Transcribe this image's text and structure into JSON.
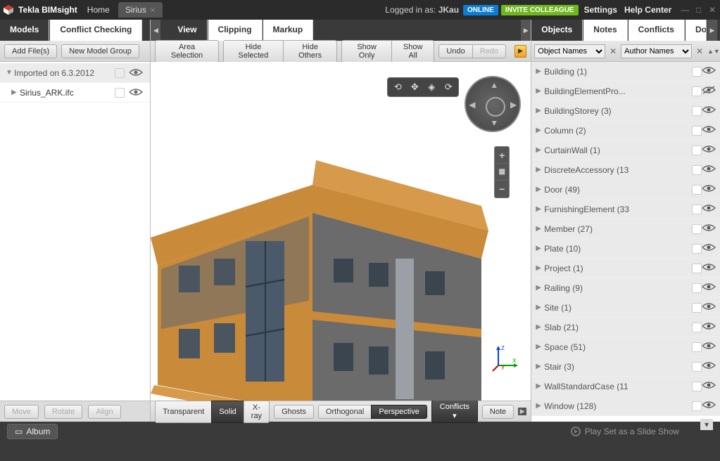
{
  "titlebar": {
    "app_name": "Tekla BIMsight",
    "tabs": [
      "Home",
      "Sirius"
    ],
    "active_tab_index": 1,
    "login_prefix": "Logged in as:",
    "username": "JKau",
    "online": "ONLINE",
    "invite": "INVITE COLLEAGUE",
    "settings": "Settings",
    "help": "Help Center"
  },
  "left_panel": {
    "tabs": [
      "Models",
      "Conflict Checking"
    ],
    "active_tab_index": 0,
    "toolbar": {
      "add_files": "Add File(s)",
      "new_group": "New Model Group"
    },
    "tree_group": "Imported on 6.3.2012",
    "tree_item": "Sirius_ARK.ifc",
    "bottom": {
      "move": "Move",
      "rotate": "Rotate",
      "align": "Align"
    }
  },
  "center": {
    "tabs": [
      "View",
      "Clipping",
      "Markup"
    ],
    "active_tab_index": 0,
    "top_tools": {
      "area_selection": "Area Selection",
      "hide_selected": "Hide Selected",
      "hide_others": "Hide Others",
      "show_only": "Show Only",
      "show_all": "Show All",
      "undo": "Undo",
      "redo": "Redo"
    },
    "bottom_tools": {
      "transparent": "Transparent",
      "solid": "Solid",
      "xray": "X-ray",
      "ghosts": "Ghosts",
      "orthogonal": "Orthogonal",
      "perspective": "Perspective",
      "conflicts": "Conflicts",
      "notes": "Note"
    }
  },
  "right_panel": {
    "tabs": [
      "Objects",
      "Notes",
      "Conflicts",
      "Doc"
    ],
    "active_tab_index": 0,
    "filter1": "Object Names",
    "filter2": "Author Names",
    "items": [
      {
        "label": "Building (1)",
        "vis": true
      },
      {
        "label": "BuildingElementPro...",
        "vis": false
      },
      {
        "label": "BuildingStorey (3)",
        "vis": true
      },
      {
        "label": "Column (2)",
        "vis": true
      },
      {
        "label": "CurtainWall (1)",
        "vis": true
      },
      {
        "label": "DiscreteAccessory (13",
        "vis": true
      },
      {
        "label": "Door (49)",
        "vis": true
      },
      {
        "label": "FurnishingElement (33",
        "vis": true
      },
      {
        "label": "Member (27)",
        "vis": true
      },
      {
        "label": "Plate (10)",
        "vis": true
      },
      {
        "label": "Project (1)",
        "vis": true
      },
      {
        "label": "Railing (9)",
        "vis": true
      },
      {
        "label": "Site (1)",
        "vis": true
      },
      {
        "label": "Slab (21)",
        "vis": true
      },
      {
        "label": "Space (51)",
        "vis": true
      },
      {
        "label": "Stair (3)",
        "vis": true
      },
      {
        "label": "WallStandardCase (11",
        "vis": true
      },
      {
        "label": "Window (128)",
        "vis": true
      }
    ]
  },
  "footer": {
    "album": "Album",
    "play_set": "Play Set as a Slide Show"
  }
}
